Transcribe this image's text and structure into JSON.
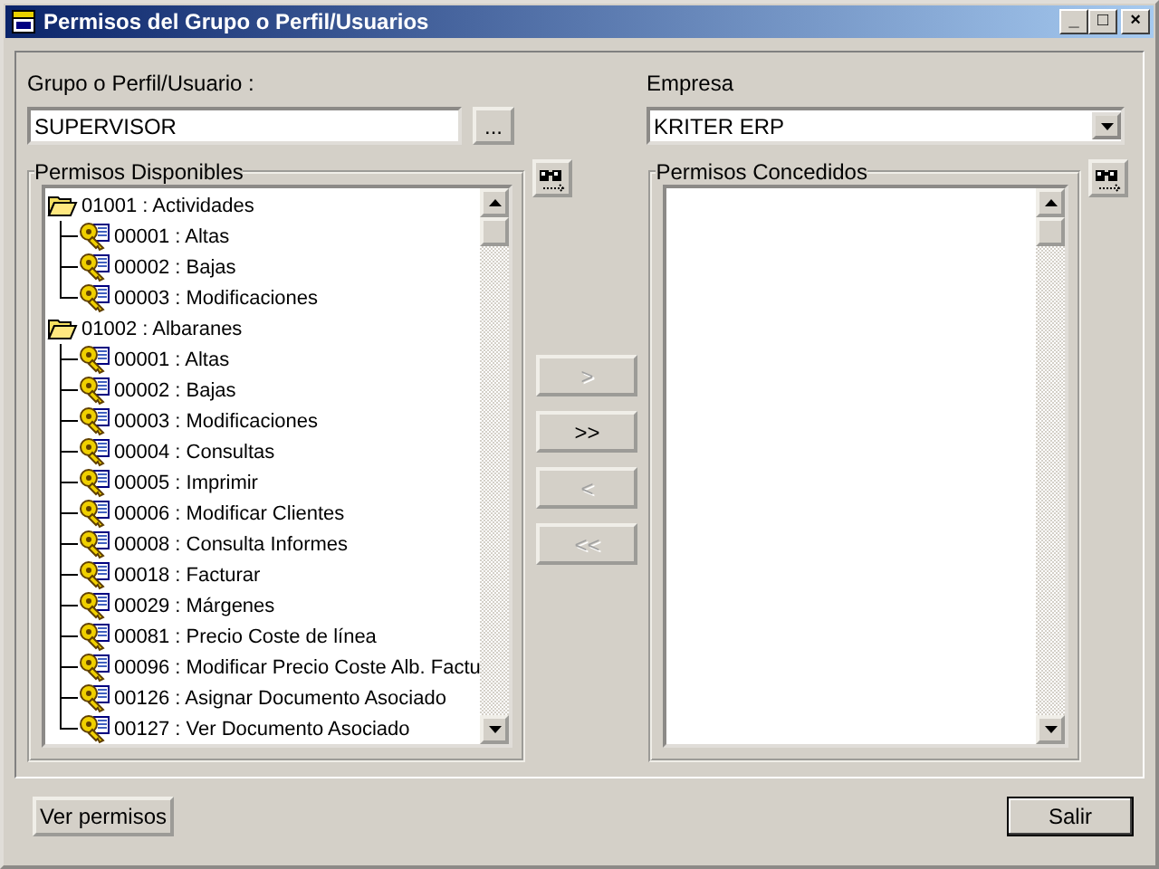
{
  "window": {
    "title": "Permisos del Grupo o Perfil/Usuarios",
    "controls": [
      "_",
      "□",
      "×"
    ]
  },
  "group_field": {
    "label": "Grupo o Perfil/Usuario :",
    "value": "SUPERVISOR",
    "browse_button": "..."
  },
  "company_field": {
    "label": "Empresa",
    "value": "KRITER ERP"
  },
  "available": {
    "title": "Permisos Disponibles",
    "tree": [
      {
        "label": "01001 : Actividades",
        "children": [
          {
            "label": "00001 : Altas"
          },
          {
            "label": "00002 : Bajas"
          },
          {
            "label": "00003 : Modificaciones"
          }
        ]
      },
      {
        "label": "01002 : Albaranes",
        "children": [
          {
            "label": "00001 : Altas"
          },
          {
            "label": "00002 : Bajas"
          },
          {
            "label": "00003 : Modificaciones"
          },
          {
            "label": "00004 : Consultas"
          },
          {
            "label": "00005 : Imprimir"
          },
          {
            "label": "00006 : Modificar Clientes"
          },
          {
            "label": "00008 : Consulta Informes"
          },
          {
            "label": "00018 : Facturar"
          },
          {
            "label": "00029 : Márgenes"
          },
          {
            "label": "00081 : Precio Coste de línea"
          },
          {
            "label": "00096 : Modificar Precio Coste Alb. Factu"
          },
          {
            "label": "00126 : Asignar Documento Asociado"
          },
          {
            "label": "00127 : Ver Documento Asociado"
          }
        ]
      }
    ]
  },
  "move_buttons": [
    {
      "label": ">",
      "disabled": true
    },
    {
      "label": ">>",
      "disabled": false
    },
    {
      "label": "<",
      "disabled": true
    },
    {
      "label": "<<",
      "disabled": true
    }
  ],
  "granted": {
    "title": "Permisos Concedidos"
  },
  "buttons": [
    {
      "label": "Ver permisos",
      "default": false
    },
    {
      "label": "Salir",
      "default": true
    }
  ]
}
